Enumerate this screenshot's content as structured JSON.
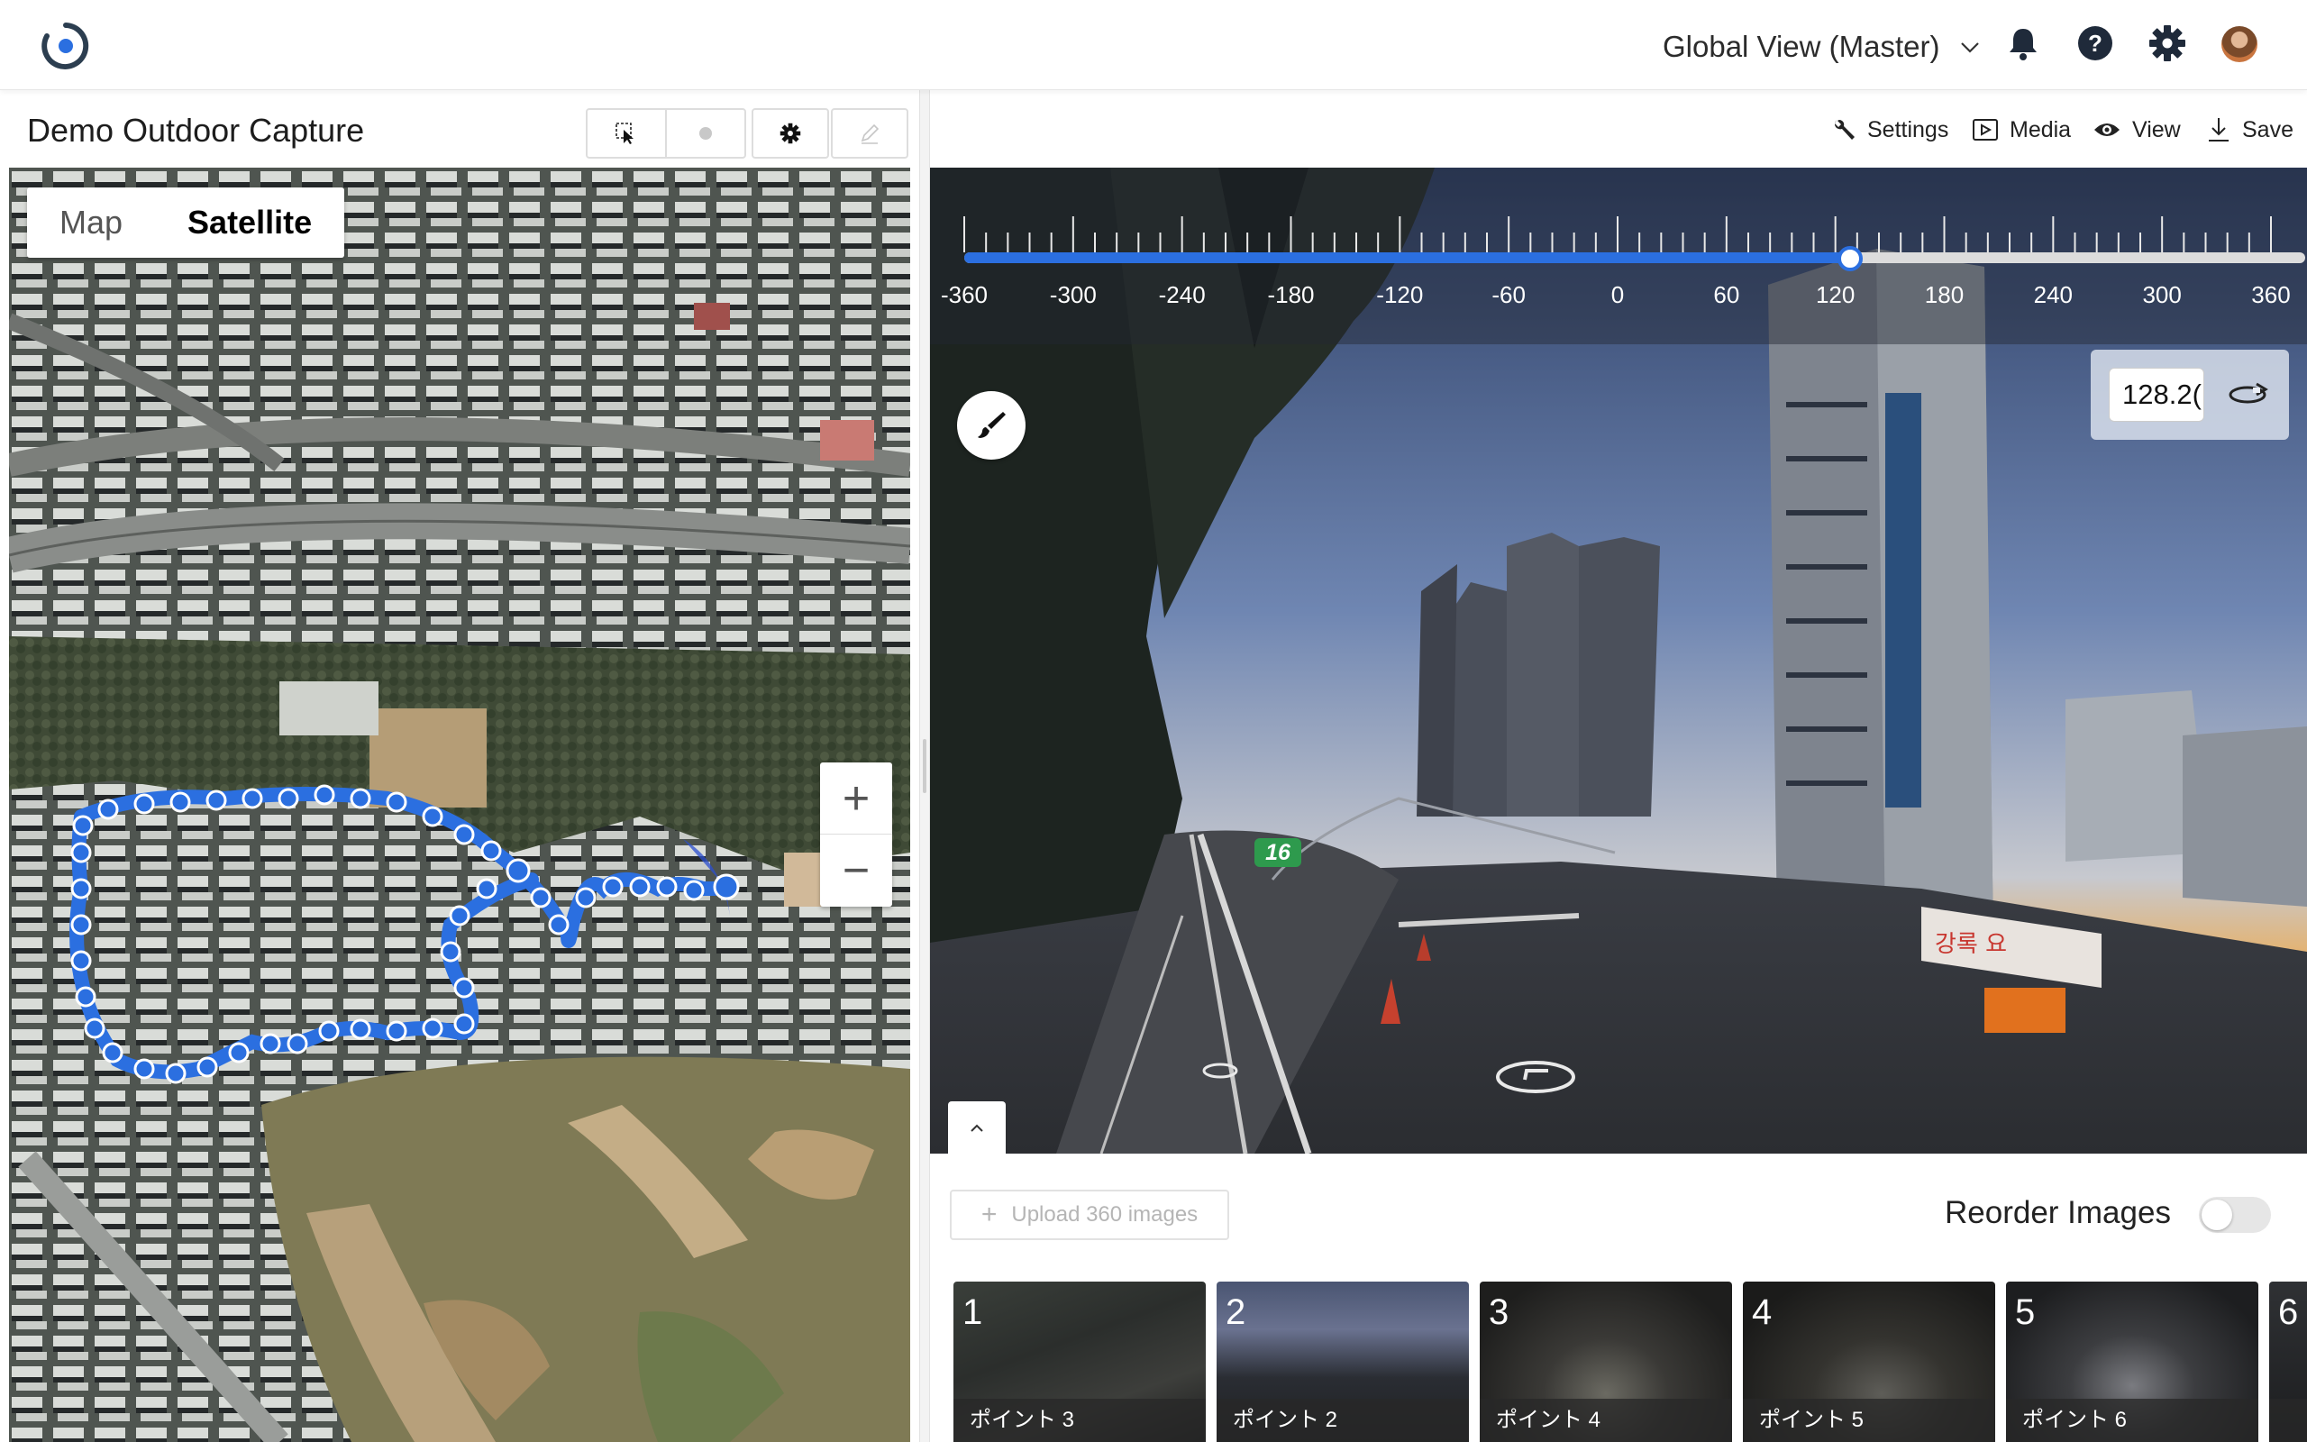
{
  "header": {
    "view_selector": "Global View (Master)",
    "icons": [
      "notification-bell-icon",
      "help-icon",
      "settings-gear-icon",
      "user-avatar"
    ]
  },
  "left_panel": {
    "title": "Demo Outdoor Capture",
    "tools": [
      "select-tool-icon",
      "point-tool-icon",
      "settings-gear-icon",
      "pen-tool-icon"
    ],
    "map_types": {
      "map": "Map",
      "satellite": "Satellite",
      "active": "Satellite"
    },
    "zoom_in": "+",
    "zoom_out": "−"
  },
  "right_panel": {
    "toolbar": {
      "settings": "Settings",
      "media": "Media",
      "view": "View",
      "save": "Save"
    },
    "rotation_slider": {
      "min": -360,
      "max": 360,
      "value": 128.2,
      "tick_labels": [
        "-360",
        "-300",
        "-240",
        "-180",
        "-120",
        "-60",
        "0",
        "60",
        "120",
        "180",
        "240",
        "300",
        "360"
      ]
    },
    "heading_value": "128.2(",
    "pano_marker_label": "16",
    "accent_color": "#2b6fe0"
  },
  "bottom": {
    "upload_label": "Upload 360 images",
    "reorder_label": "Reorder Images",
    "reorder_enabled": false,
    "thumbnails": [
      {
        "number": "1",
        "caption": "ポイント 3"
      },
      {
        "number": "2",
        "caption": "ポイント 2"
      },
      {
        "number": "3",
        "caption": "ポイント 4"
      },
      {
        "number": "4",
        "caption": "ポイント 5"
      },
      {
        "number": "5",
        "caption": "ポイント 6"
      },
      {
        "number": "6",
        "caption": ""
      }
    ]
  }
}
